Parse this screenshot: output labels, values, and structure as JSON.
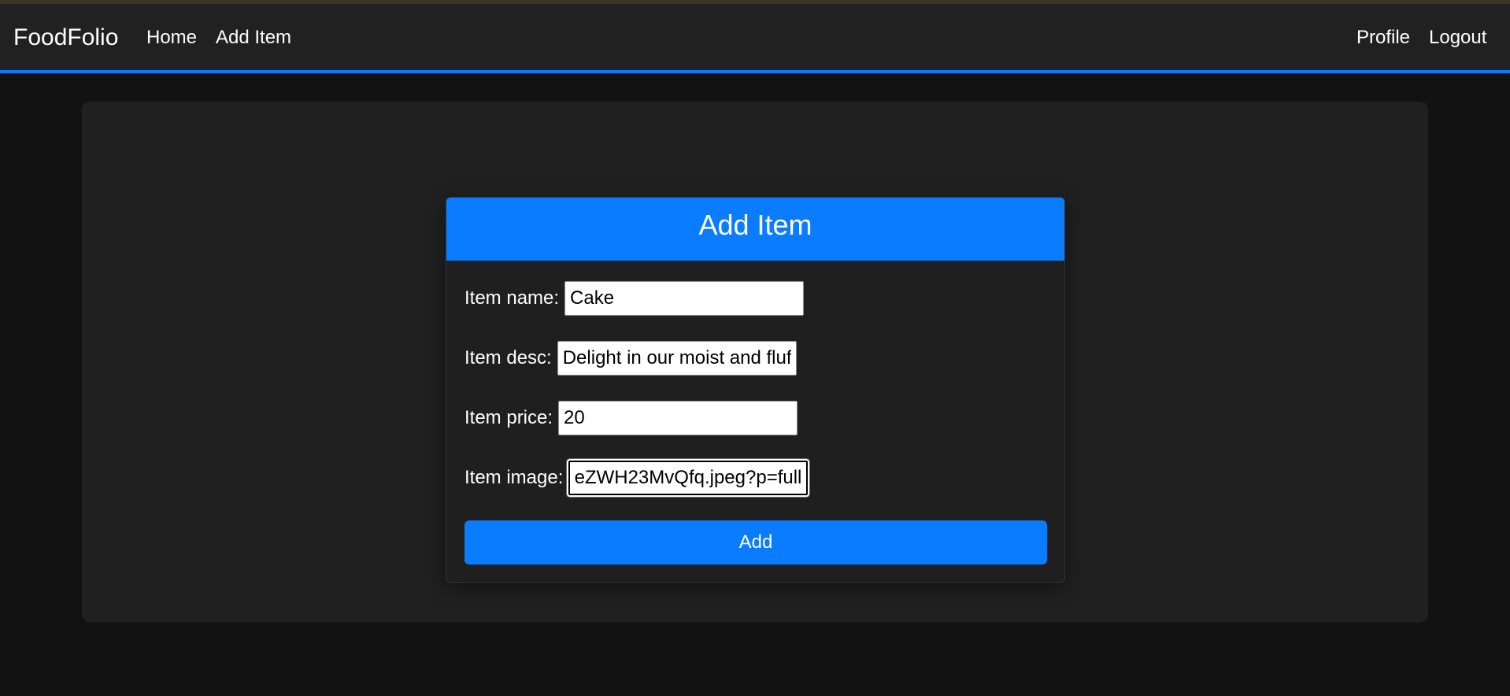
{
  "navbar": {
    "brand": "FoodFolio",
    "links": {
      "home": "Home",
      "add_item": "Add Item",
      "profile": "Profile",
      "logout": "Logout"
    },
    "accent_color": "#0a7cff"
  },
  "form": {
    "title": "Add Item",
    "fields": {
      "name": {
        "label": "Item name:",
        "value": "Cake"
      },
      "desc": {
        "label": "Item desc:",
        "value": "Delight in our moist and fluf"
      },
      "price": {
        "label": "Item price:",
        "value": "20"
      },
      "image": {
        "label": "Item image:",
        "value": "eZWH23MvQfq.jpeg?p=full"
      }
    },
    "submit_label": "Add"
  }
}
